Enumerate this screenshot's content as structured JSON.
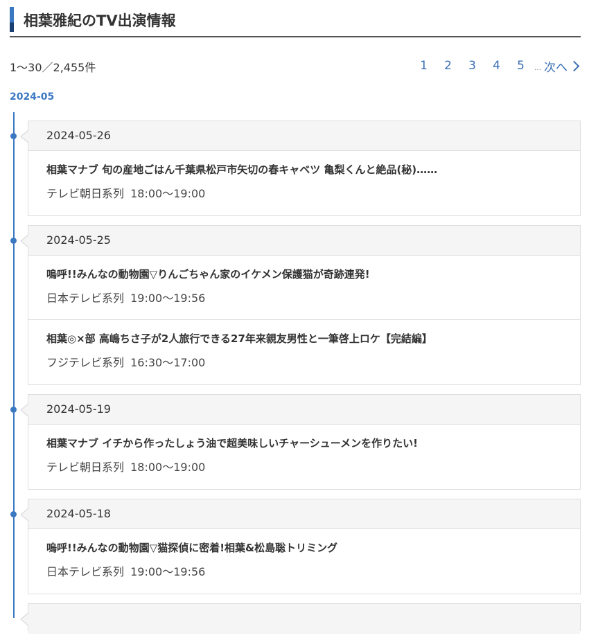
{
  "page": {
    "title": "相葉雅紀のTV出演情報"
  },
  "result_count": "1〜30／2,455件",
  "pagination": {
    "pages": [
      "1",
      "2",
      "3",
      "4",
      "5"
    ],
    "ellipsis": "…",
    "next_label": "次へ"
  },
  "month": "2024-05",
  "days": [
    {
      "date": "2024-05-26",
      "programs": [
        {
          "title": "相葉マナブ 旬の産地ごはん千葉県松戸市矢切の春キャベツ 亀梨くんと絶品(秘)……",
          "channel": "テレビ朝日系列",
          "time": "18:00〜19:00"
        }
      ]
    },
    {
      "date": "2024-05-25",
      "programs": [
        {
          "title": "嗚呼!!みんなの動物園▽りんごちゃん家のイケメン保護猫が奇跡連発!",
          "channel": "日本テレビ系列",
          "time": "19:00〜19:56"
        },
        {
          "title": "相葉◎×部 高嶋ちさ子が2人旅行できる27年来親友男性と一筆啓上ロケ【完結編】",
          "channel": "フジテレビ系列",
          "time": "16:30〜17:00"
        }
      ]
    },
    {
      "date": "2024-05-19",
      "programs": [
        {
          "title": "相葉マナブ イチから作ったしょう油で超美味しいチャーシューメンを作りたい!",
          "channel": "テレビ朝日系列",
          "time": "18:00〜19:00"
        }
      ]
    },
    {
      "date": "2024-05-18",
      "programs": [
        {
          "title": "嗚呼!!みんなの動物園▽猫探偵に密着!相葉&松島聡トリミング",
          "channel": "日本テレビ系列",
          "time": "19:00〜19:56"
        }
      ]
    }
  ],
  "colors": {
    "accent": "#3b78c2",
    "accent_dark": "#1a3f73",
    "link": "#3a6fb4",
    "header_bg": "#f5f5f5",
    "border": "#dddddd",
    "text": "#333333"
  },
  "icons": {
    "next": "chevron-right-icon",
    "timeline_marker": "dot-icon"
  }
}
